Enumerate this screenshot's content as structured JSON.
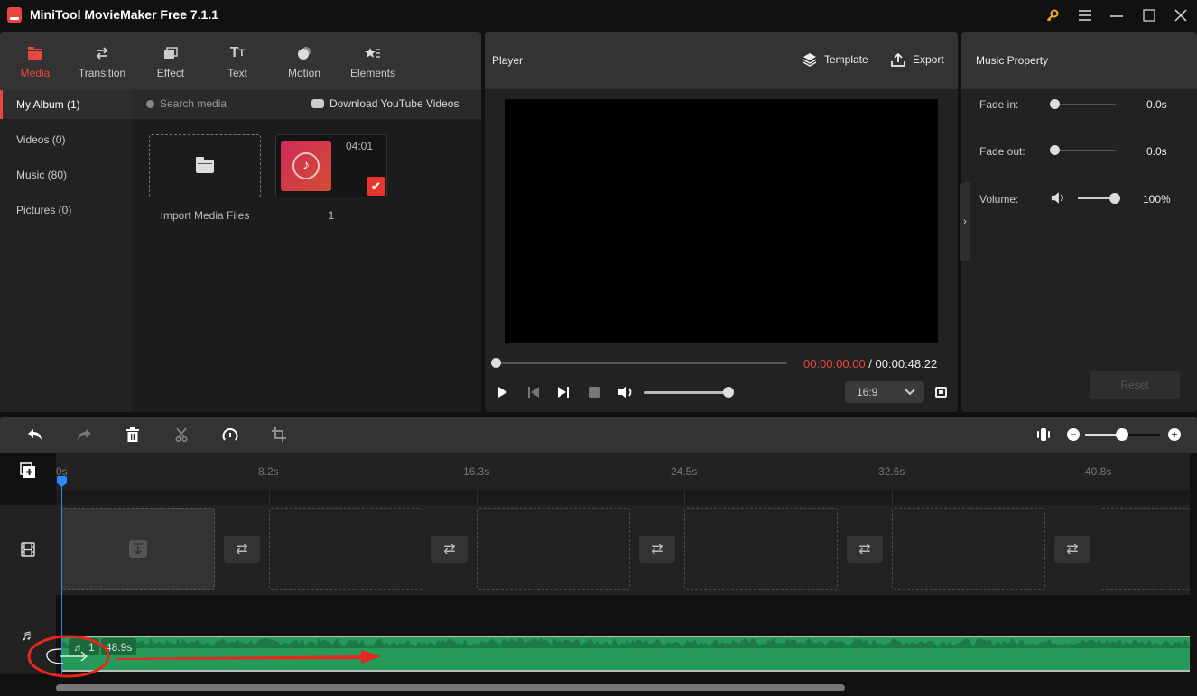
{
  "window": {
    "title": "MiniTool MovieMaker Free 7.1.1",
    "controls": [
      "key-icon",
      "menu-icon",
      "minimize-icon",
      "maximize-icon",
      "close-icon"
    ]
  },
  "toolbar_tabs": [
    {
      "label": "Media",
      "icon": "folder-icon",
      "active": true
    },
    {
      "label": "Transition",
      "icon": "swap-icon",
      "active": false
    },
    {
      "label": "Effect",
      "icon": "layers-icon",
      "active": false
    },
    {
      "label": "Text",
      "icon": "text-icon",
      "active": false
    },
    {
      "label": "Motion",
      "icon": "sphere-icon",
      "active": false
    },
    {
      "label": "Elements",
      "icon": "star-list-icon",
      "active": false
    }
  ],
  "sidebar": {
    "items": [
      {
        "label": "My Album (1)",
        "active": true
      },
      {
        "label": "Videos (0)",
        "active": false
      },
      {
        "label": "Music (80)",
        "active": false
      },
      {
        "label": "Pictures (0)",
        "active": false
      }
    ]
  },
  "media": {
    "search_placeholder": "Search media",
    "download_label": "Download YouTube Videos",
    "import_label": "Import Media Files",
    "items": [
      {
        "name": "1",
        "duration": "04:01",
        "checked": true
      }
    ]
  },
  "player": {
    "label": "Player",
    "template_label": "Template",
    "export_label": "Export",
    "current_time": "00:00:00.00",
    "separator": " / ",
    "total_time": "00:00:48.22",
    "progress": 0,
    "volume": 100,
    "aspect_ratio": "16:9"
  },
  "music_property": {
    "title": "Music Property",
    "fade_in_label": "Fade in:",
    "fade_in_value": "0.0s",
    "fade_out_label": "Fade out:",
    "fade_out_value": "0.0s",
    "volume_label": "Volume:",
    "volume_value": "100%",
    "reset_label": "Reset"
  },
  "timeline": {
    "zoom_level": 0.5,
    "ruler_ticks": [
      "0s",
      "8.2s",
      "16.3s",
      "24.5s",
      "32.6s",
      "40.8s"
    ],
    "audio_clip": {
      "index": "1",
      "duration": "48.9s"
    }
  },
  "colors": {
    "accent": "#e8473f",
    "playhead": "#2f88ff",
    "audio_clip": "#259a5a",
    "annotation": "#e8261c"
  }
}
